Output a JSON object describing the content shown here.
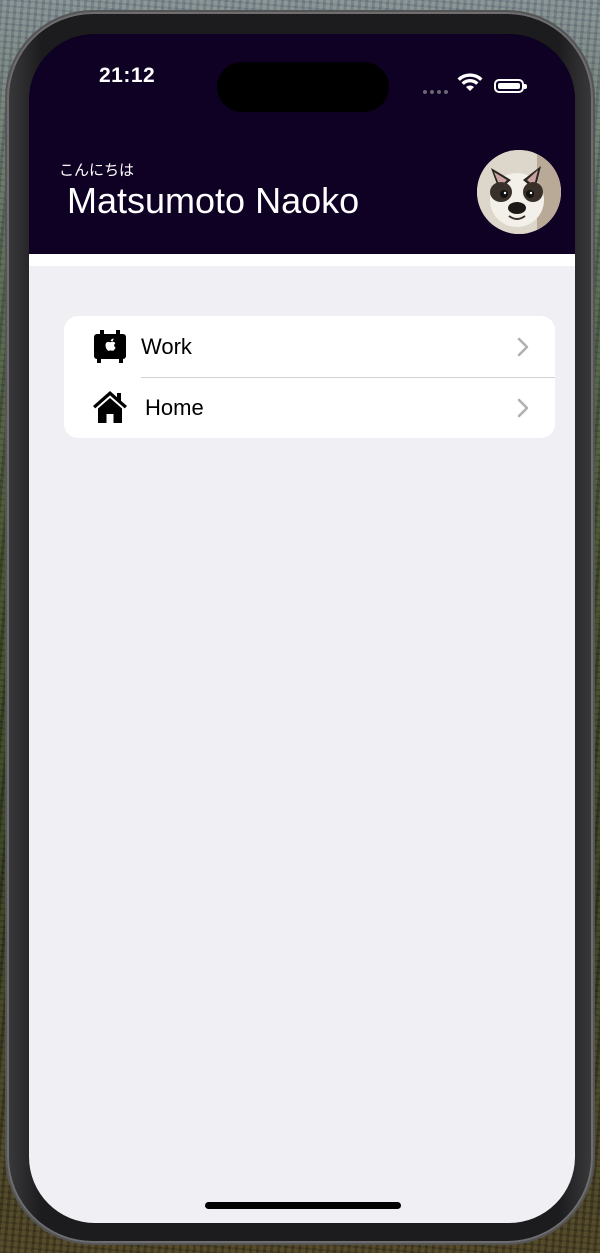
{
  "status_bar": {
    "time": "21:12",
    "icons": [
      "cellular-dots-icon",
      "wifi-icon",
      "battery-icon"
    ]
  },
  "header": {
    "greeting": "こんにちは",
    "user_name": "Matsumoto Naoko",
    "avatar": "dog-avatar",
    "background_color": "#0e0124"
  },
  "list": {
    "items": [
      {
        "label": "Work",
        "icon": "work-building-icon"
      },
      {
        "label": "Home",
        "icon": "house-icon"
      }
    ]
  },
  "colors": {
    "content_background": "#f0eff4",
    "card_background": "#ffffff",
    "chevron": "#b0b0b5",
    "separator": "#d1d1d6"
  }
}
